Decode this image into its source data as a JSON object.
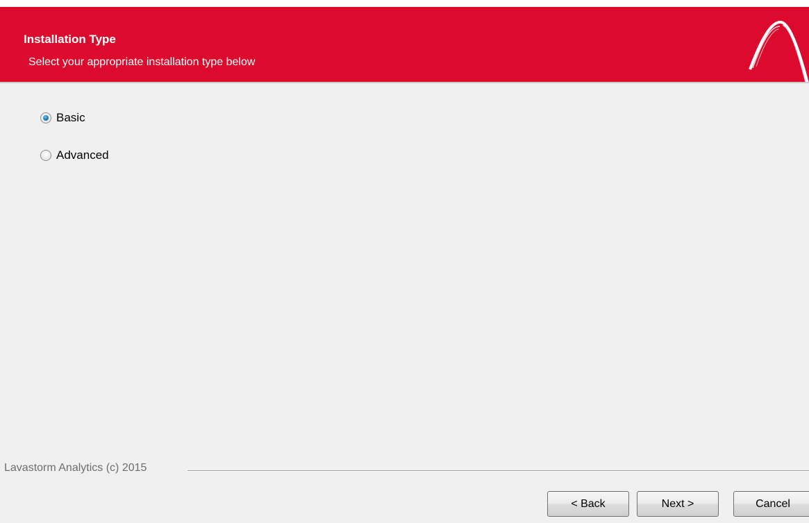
{
  "header": {
    "title": "Installation Type",
    "subtitle": "Select your appropriate installation type below",
    "accent_color": "#dc0a2d",
    "logo_icon": "lavastorm-arch-logo"
  },
  "options": [
    {
      "label": "Basic",
      "checked": true
    },
    {
      "label": "Advanced",
      "checked": false
    }
  ],
  "footer": {
    "brand": "Lavastorm Analytics (c) 2015"
  },
  "buttons": {
    "back": "< Back",
    "next": "Next >",
    "cancel": "Cancel"
  }
}
